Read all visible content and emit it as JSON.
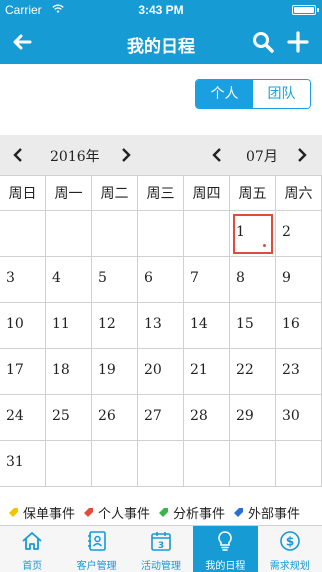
{
  "status_bar": {
    "carrier": "Carrier",
    "time": "3:43 PM",
    "battery_level": 1.0
  },
  "nav": {
    "title": "我的日程",
    "icons": [
      "back-arrow-icon",
      "search-icon",
      "add-icon"
    ]
  },
  "segments": {
    "items": [
      {
        "label": "个人",
        "selected": true
      },
      {
        "label": "团队",
        "selected": false
      }
    ]
  },
  "month_bar": {
    "year_label": "2016年",
    "month_label": "07月"
  },
  "calendar": {
    "weekdays": [
      "周日",
      "周一",
      "周二",
      "周三",
      "周四",
      "周五",
      "周六"
    ],
    "weeks": [
      [
        "",
        "",
        "",
        "",
        "",
        "1",
        "2"
      ],
      [
        "3",
        "4",
        "5",
        "6",
        "7",
        "8",
        "9"
      ],
      [
        "10",
        "11",
        "12",
        "13",
        "14",
        "15",
        "16"
      ],
      [
        "17",
        "18",
        "19",
        "20",
        "21",
        "22",
        "23"
      ],
      [
        "24",
        "25",
        "26",
        "27",
        "28",
        "29",
        "30"
      ],
      [
        "31",
        "",
        "",
        "",
        "",
        "",
        ""
      ]
    ],
    "today": "1",
    "accent": "#e04b3a"
  },
  "legend": {
    "items": [
      {
        "label": "保单事件",
        "color": "#f5c400"
      },
      {
        "label": "个人事件",
        "color": "#e84a3c"
      },
      {
        "label": "分析事件",
        "color": "#3ab54a"
      },
      {
        "label": "外部事件",
        "color": "#2a6fd6"
      }
    ]
  },
  "tabbar": {
    "tabs": [
      {
        "label": "首页",
        "icon": "home-icon",
        "active": false
      },
      {
        "label": "客户管理",
        "icon": "contacts-icon",
        "active": false
      },
      {
        "label": "活动管理",
        "icon": "calendar-icon",
        "active": false
      },
      {
        "label": "我的日程",
        "icon": "lightbulb-icon",
        "active": true
      },
      {
        "label": "需求规划",
        "icon": "dollar-icon",
        "active": false
      }
    ]
  },
  "colors": {
    "primary": "#169bd5",
    "grid": "#d0d0d0"
  }
}
